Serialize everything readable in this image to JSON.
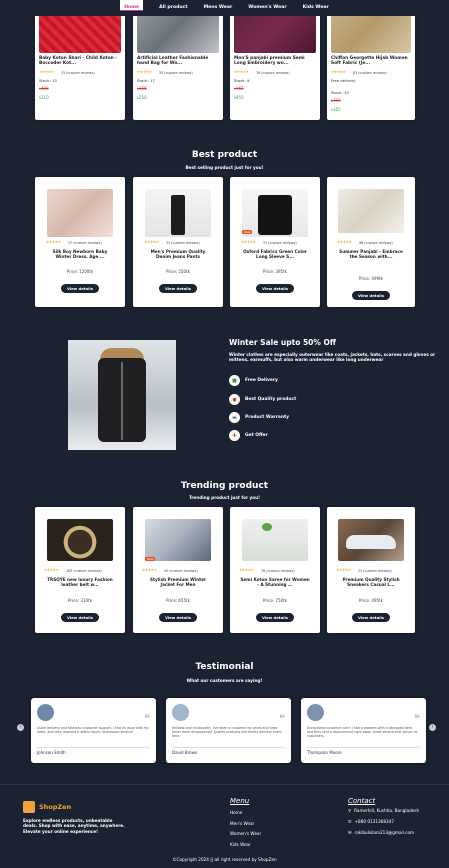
{
  "nav": {
    "items": [
      "Home",
      "All product",
      "Mens Wear",
      "Women's Wear",
      "Kids Wear"
    ]
  },
  "top_products": [
    {
      "title": "Baby Koton Shari - Child Koton - Boccoder Kot...",
      "rating": "★★★★★",
      "reviews": "25 (custom reviews)",
      "stock": "Stock: 13",
      "old": "৳400",
      "new": "৳310"
    },
    {
      "title": "Artificial Leather Fashionable hand Bag for Wo...",
      "rating": "★★★★★",
      "reviews": "35 (custom reviews)",
      "stock": "Stock: 17",
      "old": "৳365",
      "new": "৳250"
    },
    {
      "title": "Men'S panjabi premium Semi Long Embroidery wo...",
      "rating": "★★★★★",
      "reviews": "76 (custom reviews)",
      "stock": "Stock: 9",
      "old": "৳965",
      "new": "৳850"
    },
    {
      "title": "Chiffon Georgette Hijab Women Soft Fabric (Je...",
      "rating": "★★★★★",
      "reviews": "83 (custom reviews)",
      "stock": "Free delivery",
      "stock2": "Stock: 19",
      "old": "৳300",
      "new": "৳165"
    }
  ],
  "best": {
    "title": "Best product",
    "subtitle": "Best selling product just for you!",
    "items": [
      {
        "title": "Silk Boy Newborn Baby Winter Dress, Age ...",
        "rating": "★★★★★",
        "reviews": "27 (custom reviews)",
        "price": "Price: 1200tk",
        "button": "View details",
        "sale": ""
      },
      {
        "title": "Men's Premium Quality Denim Jeans Pants",
        "rating": "★★★★★",
        "reviews": "33 (custom reviews)",
        "price": "Price: 550tk",
        "button": "View details",
        "sale": ""
      },
      {
        "title": "Oxford Fabrics Green Color Long Sleeve S...",
        "rating": "★★★★★",
        "reviews": "37 (custom reviews)",
        "price": "Price: 395tk",
        "button": "View details",
        "sale": "Sale"
      },
      {
        "title": "Summer Panjabi - Embrace the Season with...",
        "rating": "★★★★★",
        "reviews": "96 (custom reviews)",
        "price": "Price: 499tk",
        "button": "View details",
        "sale": ""
      }
    ]
  },
  "winter": {
    "title": "Winter Sale upto 50% Off",
    "desc": "Winter clothes are especially outerwear like coats, jackets, hats, scarves and gloves or mittens, earmuffs, but also warm underwear like long underwear",
    "features": [
      "Free Delivery",
      "Best Quality product",
      "Product Warranty",
      "Get Offer"
    ]
  },
  "trending": {
    "title": "Trending product",
    "subtitle": "Trending product just for you!",
    "items": [
      {
        "title": "TRSOYE new luxury Fashion leather belt w...",
        "rating": "★★★★★",
        "reviews": "163 (custom reviews)",
        "price": "Price: 310tk",
        "button": "View details",
        "sale": ""
      },
      {
        "title": "Stylish Premium Winter Jacket For Men",
        "rating": "★★★★★",
        "reviews": "45 (custom reviews)",
        "price": "Price: 655tk",
        "button": "View details",
        "sale": "Sale"
      },
      {
        "title": "Semi Koton Saree for Women - A Stunning ...",
        "rating": "★★★★★",
        "reviews": "76 (custom reviews)",
        "price": "Price: 750tk",
        "button": "View details",
        "sale": ""
      },
      {
        "title": "Premium Quality Stylish Sneakers Casual L...",
        "rating": "★★★★★",
        "reviews": "23 (custom reviews)",
        "price": "Price: 495tk",
        "button": "View details",
        "sale": ""
      }
    ]
  },
  "testimonial": {
    "title": "Testimonial",
    "subtitle": "What our customers are saying!",
    "items": [
      {
        "text": "Quick delivery and fantastic customer support. I had an issue with my order, and they resolved it within hours. Impressive service!",
        "name": "Johnson Smith"
      },
      {
        "text": "Reliable and trustworthy. I've been a customer for years and have never been disappointed. Quality products and timely delivery every time.",
        "name": "David Brown"
      },
      {
        "text": "Exceptional customer care! I had a problem with a damaged item, and they sent a replacement right away. Great service that values its customers.",
        "name": "Thompson Moore"
      }
    ]
  },
  "footer": {
    "brand": "ShopZen",
    "desc": "Explore endless products, unbeatable deals. Shop with ease, anytime, anywhere. Elevate your online experience!",
    "menu_title": "Menu",
    "menu": [
      "Home",
      "Men's Wear",
      "Women's Wear",
      "Kids Wear"
    ],
    "contact_title": "Contact",
    "contacts": [
      {
        "icon": "location-icon",
        "text": "Ramerhill, Kushtia, Bangladesh"
      },
      {
        "icon": "phone-icon",
        "text": "+880 0131368347"
      },
      {
        "icon": "mail-icon",
        "text": "rakibulislam213@gmail.com"
      }
    ],
    "copyright": "©Copyright 2024 || all right reserved by ShopZen"
  },
  "colors": {
    "background": "#1b2232",
    "nav_active": "#c13a8c",
    "old_price": "#d43a3a",
    "new_price": "#29a35a",
    "stars": "#f2a91a"
  }
}
